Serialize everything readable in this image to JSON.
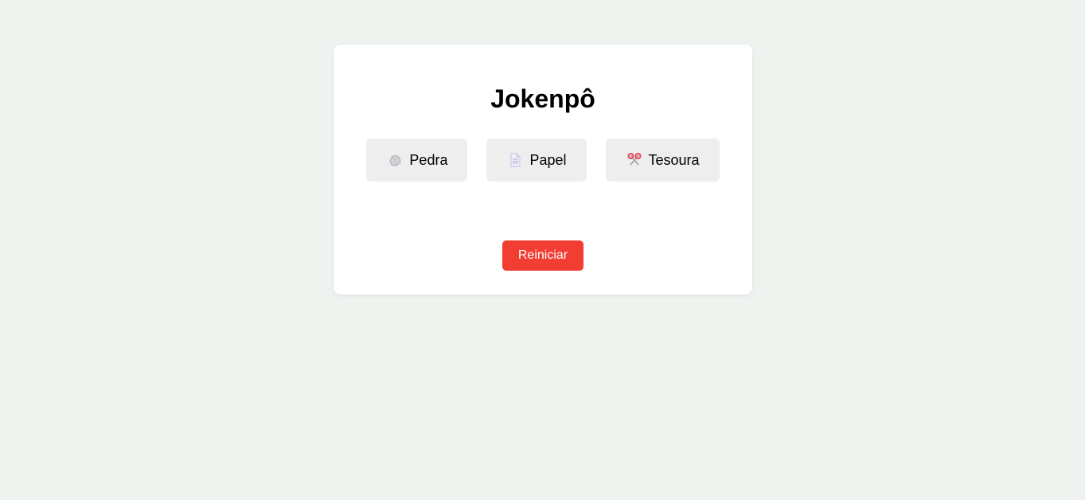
{
  "game": {
    "title": "Jokenpô",
    "choices": [
      {
        "label": "Pedra",
        "icon": "rock-icon"
      },
      {
        "label": "Papel",
        "icon": "paper-icon"
      },
      {
        "label": "Tesoura",
        "icon": "scissors-icon"
      }
    ],
    "reset_label": "Reiniciar"
  },
  "colors": {
    "background": "#eff3f0",
    "card": "#ffffff",
    "choice_button": "#eeeeee",
    "reset_button": "#f23d33"
  }
}
